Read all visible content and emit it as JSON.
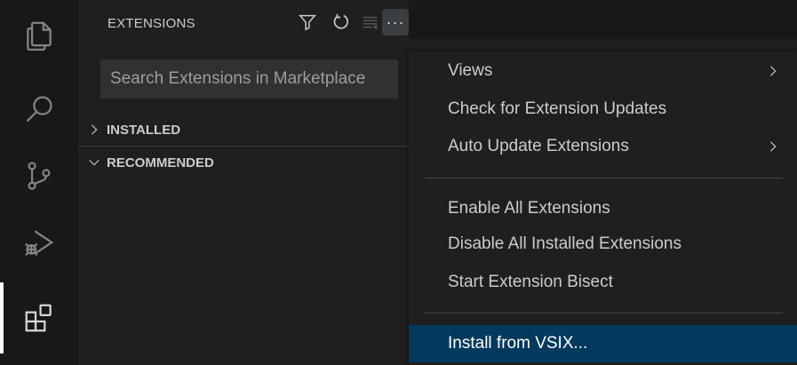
{
  "activity_bar": {
    "items": [
      {
        "icon": "explorer-icon"
      },
      {
        "icon": "search-icon"
      },
      {
        "icon": "source-control-icon"
      },
      {
        "icon": "run-debug-icon"
      },
      {
        "icon": "extensions-icon",
        "active": true
      }
    ]
  },
  "sidebar": {
    "title": "EXTENSIONS",
    "actions": [
      {
        "icon": "filter-icon"
      },
      {
        "icon": "refresh-icon"
      },
      {
        "icon": "clear-icon"
      },
      {
        "icon": "more-actions-icon",
        "label": "···"
      }
    ],
    "search": {
      "placeholder": "Search Extensions in Marketplace",
      "value": ""
    },
    "sections": [
      {
        "label": "INSTALLED",
        "expanded": false
      },
      {
        "label": "RECOMMENDED",
        "expanded": true
      }
    ]
  },
  "context_menu": {
    "items": [
      {
        "label": "Views",
        "submenu": true
      },
      {
        "label": "Check for Extension Updates"
      },
      {
        "label": "Auto Update Extensions",
        "submenu": true
      },
      {
        "separator": true
      },
      {
        "label": "Enable All Extensions"
      },
      {
        "label": "Disable All Installed Extensions"
      },
      {
        "label": "Start Extension Bisect"
      },
      {
        "separator": true
      },
      {
        "label": "Install from VSIX...",
        "selected": true
      }
    ]
  },
  "colors": {
    "background": "#1f1f1f",
    "activity_bar": "#181818",
    "selection": "#04395e",
    "text": "#cccccc"
  }
}
